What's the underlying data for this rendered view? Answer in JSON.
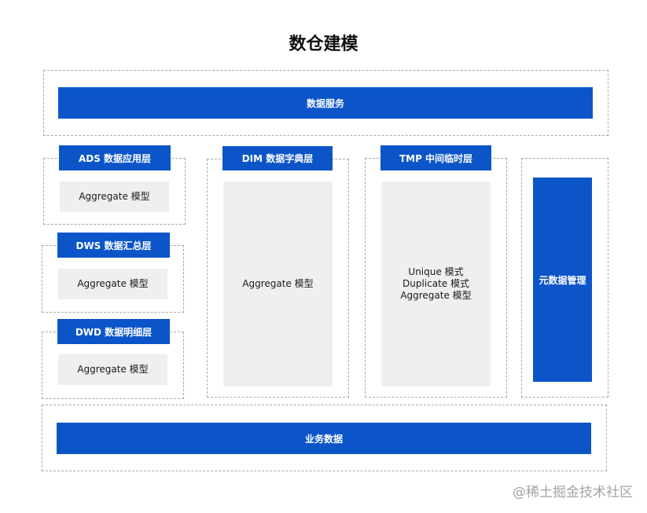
{
  "title": "数仓建模",
  "data_service": {
    "label": "数据服务"
  },
  "layers": {
    "ads": {
      "header": "ADS 数据应用层",
      "content": "Aggregate 模型"
    },
    "dws": {
      "header": "DWS 数据汇总层",
      "content": "Aggregate 模型"
    },
    "dwd": {
      "header": "DWD 数据明细层",
      "content": "Aggregate 模型"
    },
    "dim": {
      "header": "DIM 数据字典层",
      "content": "Aggregate 模型"
    },
    "tmp": {
      "header": "TMP 中间临时层",
      "content": [
        "Unique 模式",
        "Duplicate 模式",
        "Aggregate 模型"
      ]
    }
  },
  "metadata": {
    "label": "元数据管理"
  },
  "business_data": {
    "label": "业务数据"
  },
  "watermark": "@稀土掘金技术社区",
  "colors": {
    "accent_blue": "#0b55c8",
    "panel_grey": "#efefef",
    "dashed_border": "#a9a9a9"
  }
}
